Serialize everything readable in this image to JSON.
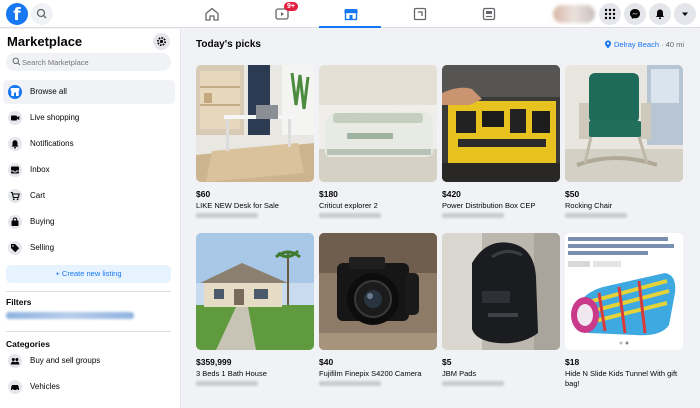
{
  "topbar": {
    "logo": "f",
    "notification_badge": "9+",
    "icons": [
      "search-icon",
      "home-icon",
      "watch-icon",
      "marketplace-icon",
      "groups-icon",
      "gaming-icon",
      "menu-grid-icon",
      "messenger-icon",
      "bell-icon",
      "caret-down-icon"
    ]
  },
  "sidebar": {
    "title": "Marketplace",
    "search_placeholder": "Search Marketplace",
    "items": [
      {
        "label": "Browse all",
        "icon": "storefront-icon"
      },
      {
        "label": "Live shopping",
        "icon": "live-icon"
      },
      {
        "label": "Notifications",
        "icon": "bell-icon"
      },
      {
        "label": "Inbox",
        "icon": "inbox-icon"
      },
      {
        "label": "Cart",
        "icon": "cart-icon"
      },
      {
        "label": "Buying",
        "icon": "bag-icon"
      },
      {
        "label": "Selling",
        "icon": "tag-icon"
      }
    ],
    "create_label": "+ Create new listing",
    "filters_heading": "Filters",
    "categories_heading": "Categories",
    "categories": [
      {
        "label": "Buy and sell groups",
        "icon": "groups-icon"
      },
      {
        "label": "Vehicles",
        "icon": "car-icon"
      }
    ]
  },
  "main": {
    "title": "Today's picks",
    "location": "Delray Beach",
    "distance": "· 40 mi",
    "listings": [
      {
        "price": "$60",
        "title": "LIKE NEW Desk for Sale"
      },
      {
        "price": "$180",
        "title": "Criticut explorer 2"
      },
      {
        "price": "$420",
        "title": "Power Distribution Box CEP"
      },
      {
        "price": "$50",
        "title": "Rocking Chair"
      },
      {
        "price": "$359,999",
        "title": "3 Beds 1 Bath House"
      },
      {
        "price": "$40",
        "title": "Fujifilm Finepix S4200 Camera"
      },
      {
        "price": "$5",
        "title": "JBM Pads"
      },
      {
        "price": "$18",
        "title": "Hide N Slide Kids Tunnel With gift bag!"
      }
    ]
  },
  "colors": {
    "accent": "#1877f2",
    "background": "#f0f2f5",
    "badge": "#e41e3f"
  }
}
